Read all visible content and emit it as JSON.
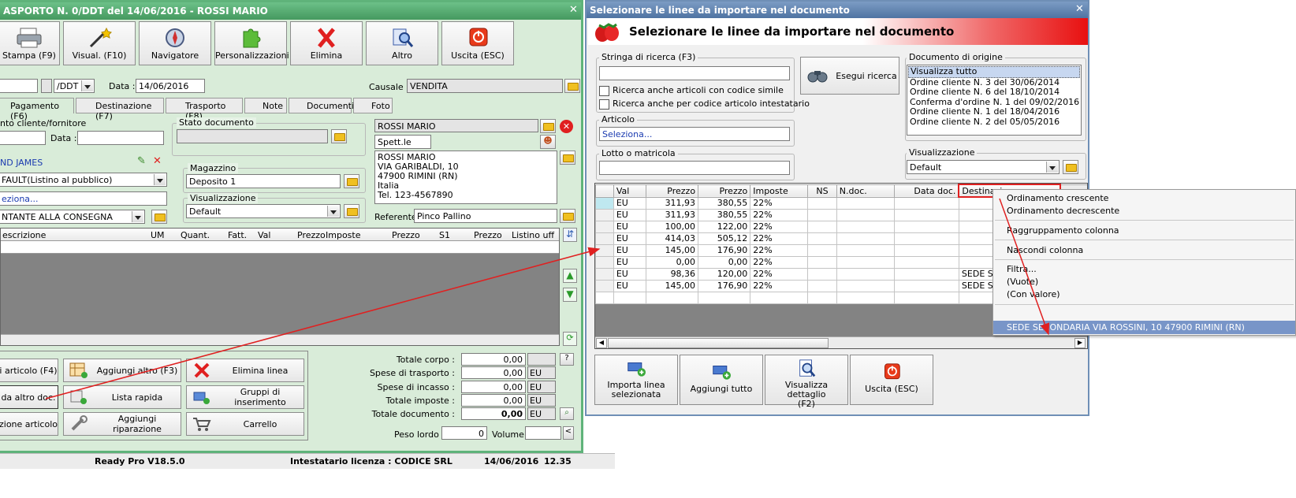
{
  "left_window": {
    "title": "ASPORTO N. 0/DDT del 14/06/2016 - ROSSI MARIO",
    "toolbar": [
      "Stampa (F9)",
      "Visual. (F10)",
      "Navigatore",
      "Personalizzazioni",
      "Elimina",
      "Altro",
      "Uscita (ESC)"
    ],
    "header": {
      "doc_type": "/DDT",
      "data_label": "Data :",
      "data_value": "14/06/2016",
      "causale_label": "Causale :",
      "causale_value": "VENDITA"
    },
    "tabs": [
      "Pagamento (F6)",
      "Destinazione (F7)",
      "Trasporto (F8)",
      "Note",
      "Documenti",
      "Foto"
    ],
    "left_panel": {
      "group_label": "nto cliente/fornitore",
      "data_label": "Data :",
      "agent": "ND JAMES",
      "listino": "FAULT(Listino al pubblico)",
      "seleziona": "eziona...",
      "pagamento": "NTANTE ALLA CONSEGNA"
    },
    "stato": {
      "label": "Stato documento"
    },
    "magazzino": {
      "label": "Magazzino",
      "value": "Deposito 1"
    },
    "visualizzazione": {
      "label": "Visualizzazione",
      "value": "Default"
    },
    "cliente": {
      "name": "ROSSI MARIO",
      "salutation": "Spett.le",
      "address": [
        "ROSSI MARIO",
        "VIA GARIBALDI, 10",
        "47900 RIMINI (RN)",
        "Italia",
        "Tel. 123-4567890"
      ],
      "referente_label": "Referente",
      "referente_value": "Pinco Pallino"
    },
    "grid_headers": [
      "escrizione",
      "UM",
      "Quant.",
      "Fatt.",
      "Val",
      "Prezzo",
      "Imposte",
      "Prezzo",
      "S1",
      "Prezzo",
      "Listino uff"
    ],
    "bottom_buttons": [
      "i articolo (F4)",
      "Aggiungi altro (F3)",
      "Elimina linea",
      "da altro doc.",
      "Lista rapida",
      "Gruppi di inserimento",
      "zione articolo",
      "Aggiungi riparazione",
      "Carrello"
    ],
    "totals": [
      {
        "label": "Totale corpo :",
        "value": "0,00",
        "cur": ""
      },
      {
        "label": "Spese di trasporto :",
        "value": "0,00",
        "cur": "EU"
      },
      {
        "label": "Spese di incasso :",
        "value": "0,00",
        "cur": "EU"
      },
      {
        "label": "Totale imposte :",
        "value": "0,00",
        "cur": "EU"
      },
      {
        "label": "Totale documento :",
        "value": "0,00",
        "cur": "EU"
      }
    ],
    "help_btn": "?",
    "peso_label": "Peso lordo :",
    "peso_value": "0",
    "volume_label": "Volume :",
    "volume_btn": "<"
  },
  "status_bar": {
    "version": "Ready Pro V18.5.0",
    "license": "Intestatario licenza : CODICE SRL",
    "date": "14/06/2016",
    "time": "12.35"
  },
  "dialog": {
    "title": "Selezionare le linee da importare nel documento",
    "banner": "Selezionare le linee da importare nel documento",
    "search_label": "Stringa di ricerca (F3)",
    "search_value": "",
    "esegui": "Esegui ricerca",
    "check1": "Ricerca anche articoli con codice simile",
    "check2": "Ricerca anche per codice articolo intestatario",
    "articolo_label": "Articolo",
    "articolo_value": "Seleziona...",
    "lotto_label": "Lotto o matricola",
    "origine_label": "Documento di origine",
    "origine_items": [
      "Visualizza tutto",
      "Ordine cliente N. 3 del 30/06/2014",
      "Ordine cliente N. 6 del 18/10/2014",
      "Conferma d'ordine N. 1 del 09/02/2016",
      "Ordine cliente N. 1 del 18/04/2016",
      "Ordine cliente N. 2 del 05/05/2016"
    ],
    "vis_label": "Visualizzazione",
    "vis_value": "Default",
    "grid_headers": [
      "Val",
      "Prezzo",
      "Prezzo",
      "Imposte",
      "NS",
      "N.doc.",
      "Data doc.",
      "Destinazione"
    ],
    "rows": [
      [
        "EU",
        "311,93",
        "380,55",
        "22%",
        "",
        "",
        "",
        ""
      ],
      [
        "EU",
        "311,93",
        "380,55",
        "22%",
        "",
        "",
        "",
        ""
      ],
      [
        "EU",
        "100,00",
        "122,00",
        "22%",
        "",
        "",
        "",
        ""
      ],
      [
        "EU",
        "414,03",
        "505,12",
        "22%",
        "",
        "",
        "",
        ""
      ],
      [
        "EU",
        "145,00",
        "176,90",
        "22%",
        "",
        "",
        "",
        ""
      ],
      [
        "EU",
        "0,00",
        "0,00",
        "22%",
        "",
        "",
        "",
        ""
      ],
      [
        "EU",
        "98,36",
        "120,00",
        "22%",
        "",
        "",
        "",
        "SEDE SECONDARIA"
      ],
      [
        "EU",
        "145,00",
        "176,90",
        "22%",
        "",
        "",
        "",
        "SEDE SECONDARIA"
      ]
    ],
    "buttons": [
      "Importa linea selezionata",
      "Aggiungi tutto",
      "Visualizza dettaglio (F2)",
      "Uscita (ESC)"
    ]
  },
  "context_menu": {
    "items": [
      "Ordinamento crescente",
      "Ordinamento decrescente",
      "Raggruppamento colonna",
      "Nascondi colonna",
      "Filtra...",
      "(Vuote)",
      "(Con valore)"
    ],
    "selected": "SEDE SECONDARIA VIA ROSSINI, 10 47900 RIMINI (RN)"
  },
  "colors": {
    "left_title": "#4fa36a",
    "dialog_title": "#4a6f9a",
    "banner_red": "#e81010",
    "accent_red": "#e02020",
    "menu_selected": "#7895c8"
  }
}
